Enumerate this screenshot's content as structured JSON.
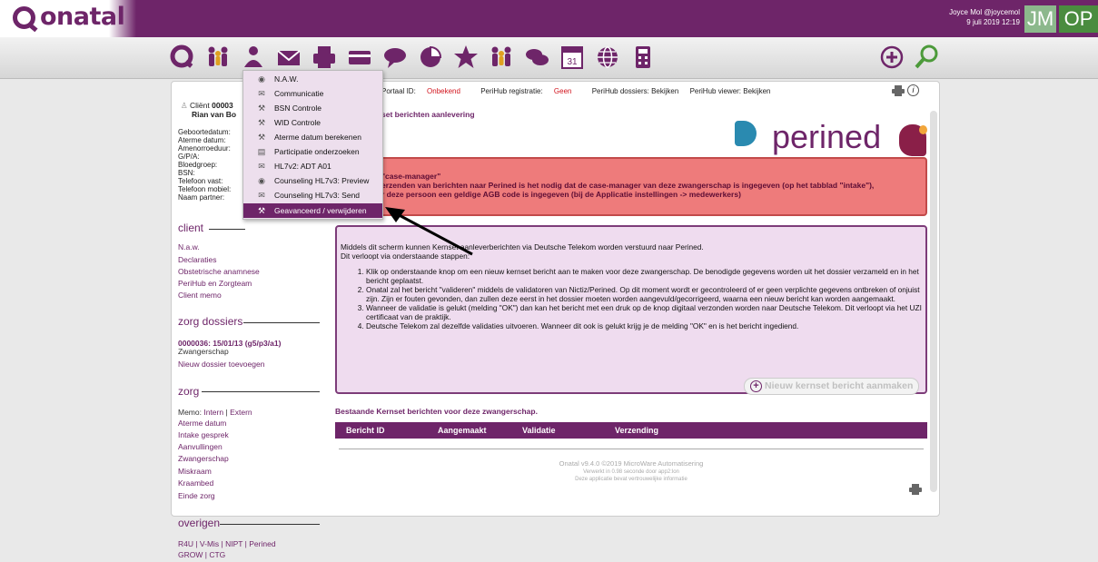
{
  "app": {
    "logo_text": "onatal"
  },
  "user": {
    "name_handle": "Joyce Mol @joycemol",
    "datetime": "9 juli 2019 12:19",
    "initials": "JM",
    "role_badge": "OP"
  },
  "toolbar": {
    "icons": [
      "onatal-home-icon",
      "people-icon",
      "person-menu-icon",
      "envelope-icon",
      "printer-icon",
      "card-icon",
      "speech-bubble-icon",
      "pie-chart-icon",
      "star-icon",
      "group-icon",
      "chat-icon",
      "calendar-icon",
      "globe-icon",
      "calculator-icon"
    ],
    "calendar_day": "31",
    "right_icons": [
      "add-icon",
      "search-icon"
    ]
  },
  "menu": {
    "items": [
      {
        "label": "N.A.W.",
        "icon": "eye-icon"
      },
      {
        "label": "Communicatie",
        "icon": "envelope-icon"
      },
      {
        "label": "BSN Controle",
        "icon": "wrench-icon"
      },
      {
        "label": "WID Controle",
        "icon": "wrench-icon"
      },
      {
        "label": "Aterme datum berekenen",
        "icon": "wrench-icon"
      },
      {
        "label": "Participatie onderzoeken",
        "icon": "document-icon"
      },
      {
        "label": "HL7v2: ADT A01",
        "icon": "envelope-icon"
      },
      {
        "label": "Counseling HL7v3: Preview",
        "icon": "eye-icon"
      },
      {
        "label": "Counseling HL7v3: Send",
        "icon": "envelope-icon"
      },
      {
        "label": "Geavanceerd / verwijderen",
        "icon": "wrench-icon",
        "selected": true
      }
    ]
  },
  "client": {
    "label_prefix": "Cliënt",
    "id_partial": "00003",
    "name_partial": "Rian van Bo",
    "fields": [
      "Geboortedatum:",
      "Aterme datum:",
      "Amenorroeduur:",
      "G/P/A:",
      "Bloedgroep:",
      "BSN:",
      "Telefoon vast:",
      "Telefoon mobiel:",
      "Naam partner:"
    ]
  },
  "sidebar": {
    "client_heading": "client",
    "client_links": [
      "N.a.w.",
      "Declaraties",
      "Obstetrische anamnese",
      "PeriHub en Zorgteam",
      "Client memo"
    ],
    "dossiers_heading": "zorg dossiers",
    "dossier_link": "0000036: 15/01/13 (g5/p3/a1)",
    "dossier_type": "Zwangerschap",
    "dossier_add": "Nieuw dossier toevoegen",
    "zorg_heading": "zorg",
    "memo_label": "Memo:",
    "memo_intern": "Intern",
    "memo_sep": "|",
    "memo_extern": "Extern",
    "zorg_links": [
      "Aterme datum",
      "Intake gesprek",
      "Aanvullingen",
      "Zwangerschap",
      "Miskraam",
      "Kraambed",
      "Einde zorg"
    ],
    "overigen_heading": "overigen",
    "overigen_line1": "R4U | V-Mis | NIPT | Perined",
    "overigen_line2": "GROW | CTG"
  },
  "portal": {
    "portaal_label": "Portaal ID:",
    "portaal_value": "Onbekend",
    "registratie_label": "PeriHub registratie:",
    "registratie_value": "Geen",
    "dossiers": "PeriHub dossiers: Bekijken",
    "viewer": "PeriHub viewer: Bekijken"
  },
  "page": {
    "title_partial": "set berichten aanlevering",
    "brand": "perined",
    "warning_title": "\"case-manager\"",
    "warning_line1": "erzenden van berichten naar Perined is het nodig dat de case-manager van deze zwangerschap is ingegeven (op het tabblad \"intake\"),",
    "warning_line2": "r deze persoon een geldige AGB code is ingegeven (bij de Applicatie instellingen -> medewerkers)",
    "info_intro1": "Middels dit scherm kunnen Kernset aanleverberichten via Deutsche Telekom worden verstuurd naar Perined.",
    "info_intro2": "Dit verloopt via onderstaande stappen:",
    "steps": [
      "Klik op onderstaande knop om een nieuw kernset bericht aan te maken voor deze zwangerschap. De benodigde gegevens worden uit het dossier verzameld en in het bericht geplaatst.",
      "Onatal zal het bericht \"valideren\" middels de validatoren van Nictiz/Perined. Op dit moment wordt er gecontroleerd of er geen verplichte gegevens ontbreken of onjuist zijn. Zijn er fouten gevonden, dan zullen deze eerst in het dossier moeten worden aangevuld/gecorrigeerd, waarna een nieuw bericht kan worden aangemaakt.",
      "Wanneer de validatie is gelukt (melding \"OK\") dan kan het bericht met een druk op de knop digitaal verzonden worden naar Deutsche Telekom. Dit verloopt via het UZI certificaat van de praktijk.",
      "Deutsche Telekom zal dezelfde validaties uitvoeren. Wanneer dit ook is gelukt krijg je de melding \"OK\" en is het bericht ingediend."
    ],
    "new_button": "Nieuw kernset bericht aanmaken",
    "existing_heading": "Bestaande Kernset berichten voor deze zwangerschap.",
    "table_headers": [
      "Bericht ID",
      "Aangemaakt",
      "Validatie",
      "Verzending"
    ],
    "footer_line1": "Onatal v9.4.0 ©2019 MicroWare Automatisering",
    "footer_line2": "Verwerkt in 0.98 seconde door app2:lon",
    "footer_line3": "Deze applicatie bevat vertrouwelijke informatie"
  },
  "colors": {
    "brand_purple": "#6e2569",
    "warning_red": "#ee7b7b",
    "info_lilac": "#efdcef",
    "green": "#4a8c3f"
  }
}
